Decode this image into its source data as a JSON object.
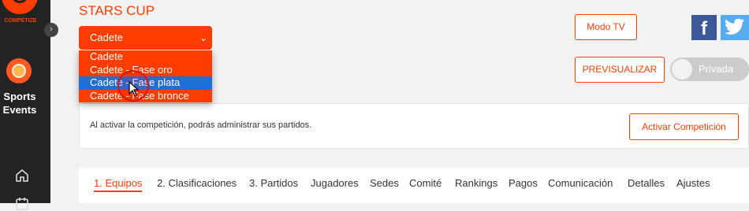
{
  "sidebar": {
    "logo_text": "COMPETIZE",
    "collapse_glyph": "›",
    "section_label_line1": "Sports",
    "section_label_line2": "Events"
  },
  "header": {
    "title": "STARS CUP",
    "select_value": "Cadete",
    "select_chevron": "⌄"
  },
  "dropdown": {
    "options": [
      "Cadete",
      "Cadete - Fase oro",
      "Cadete - Fase plata",
      "Cadete - Fase bronce"
    ],
    "highlighted_index": 2
  },
  "actions": {
    "modo_tv": "Modo TV",
    "previsualizar": "PREVISUALIZAR",
    "privacy_toggle": "Privada",
    "facebook_glyph": "f"
  },
  "activation": {
    "message": "Al activar la competición, podrás administrar sus partidos.",
    "button": "Activar Competición"
  },
  "tabs": [
    "1. Equipos",
    "2. Clasificaciones",
    "3. Partidos",
    "Jugadores",
    "Sedes",
    "Comité",
    "Rankings",
    "Pagos",
    "Comunicación",
    "Detalles",
    "Ajustes"
  ],
  "colors": {
    "accent": "#ff3d00",
    "sidebar_bg": "#232323",
    "selected_option": "#1e6fd9",
    "facebook": "#3b5998",
    "twitter": "#55acee"
  }
}
